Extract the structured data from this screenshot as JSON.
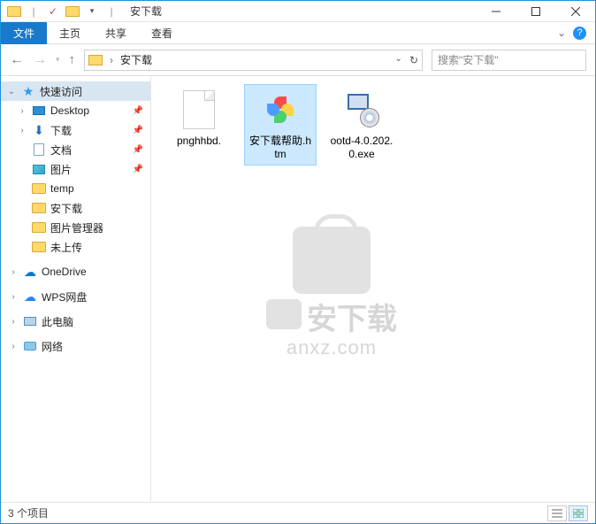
{
  "window": {
    "title": "安下载"
  },
  "qat": {
    "item1": "folder",
    "item2": "check",
    "item3": "folder-up"
  },
  "ribbon": {
    "file": "文件",
    "tabs": [
      "主页",
      "共享",
      "查看"
    ]
  },
  "address": {
    "crumb": "安下载"
  },
  "search": {
    "placeholder": "搜索\"安下载\""
  },
  "tree": {
    "quick": "快速访问",
    "pinned": [
      {
        "label": "Desktop",
        "icon": "desktop"
      },
      {
        "label": "下载",
        "icon": "download"
      },
      {
        "label": "文档",
        "icon": "document"
      },
      {
        "label": "图片",
        "icon": "pictures"
      }
    ],
    "folders": [
      "temp",
      "安下载",
      "图片管理器",
      "未上传"
    ],
    "sections": [
      {
        "label": "OneDrive",
        "icon": "onedrive"
      },
      {
        "label": "WPS网盘",
        "icon": "wps"
      },
      {
        "label": "此电脑",
        "icon": "pc"
      },
      {
        "label": "网络",
        "icon": "network"
      }
    ]
  },
  "items": [
    {
      "name": "pnghhbd.",
      "type": "file"
    },
    {
      "name": "安下载帮助.htm",
      "type": "htm",
      "selected": true
    },
    {
      "name": "ootd-4.0.202.0.exe",
      "type": "exe"
    }
  ],
  "watermark": {
    "text": "安下载",
    "domain": "anxz.com"
  },
  "status": {
    "count": "3 个项目"
  }
}
